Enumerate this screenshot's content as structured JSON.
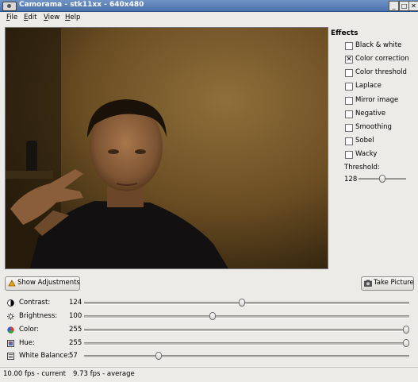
{
  "window": {
    "title": "Camorama - stk11xx - 640x480",
    "buttons": {
      "minimize": "_",
      "maximize": "□",
      "close": "✕"
    }
  },
  "menubar": {
    "items": [
      "File",
      "Edit",
      "View",
      "Help"
    ]
  },
  "effects": {
    "title": "Effects",
    "items": [
      {
        "label": "Black & white",
        "checked": false
      },
      {
        "label": "Color correction",
        "checked": true
      },
      {
        "label": "Color threshold",
        "checked": false
      },
      {
        "label": "Laplace",
        "checked": false
      },
      {
        "label": "Mirror image",
        "checked": false
      },
      {
        "label": "Negative",
        "checked": false
      },
      {
        "label": "Smoothing",
        "checked": false
      },
      {
        "label": "Sobel",
        "checked": false
      },
      {
        "label": "Wacky",
        "checked": false
      }
    ],
    "threshold": {
      "label": "Threshold:",
      "value": "128",
      "fraction": 0.5
    }
  },
  "buttons": {
    "show_adjustments": "Show Adjustments",
    "take_picture": "Take Picture"
  },
  "adjustments": [
    {
      "id": "contrast",
      "label": "Contrast:",
      "value": "124",
      "fraction": 0.486,
      "icon": "contrast-icon"
    },
    {
      "id": "brightness",
      "label": "Brightness:",
      "value": "100",
      "fraction": 0.392,
      "icon": "brightness-icon"
    },
    {
      "id": "color",
      "label": "Color:",
      "value": "255",
      "fraction": 1.0,
      "icon": "color-wheel-icon"
    },
    {
      "id": "hue",
      "label": "Hue:",
      "value": "255",
      "fraction": 1.0,
      "icon": "hue-icon"
    },
    {
      "id": "white_balance",
      "label": "White Balance:",
      "value": "57",
      "fraction": 0.224,
      "icon": "white-balance-icon"
    }
  ],
  "status": {
    "current": "10.00 fps - current",
    "average": "9.73 fps - average"
  }
}
